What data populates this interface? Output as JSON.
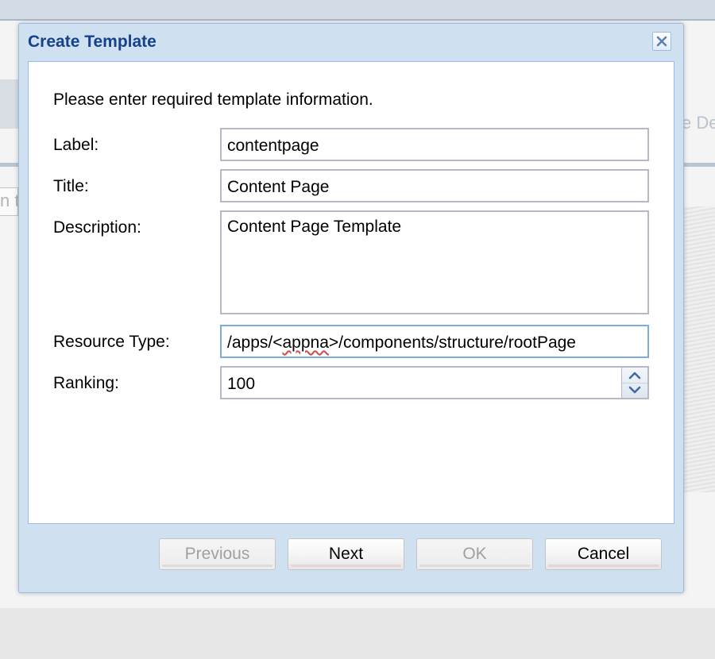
{
  "dialog": {
    "title": "Create Template",
    "intro": "Please enter required template information."
  },
  "fields": {
    "label": {
      "label": "Label:",
      "value": "contentpage"
    },
    "title": {
      "label": "Title:",
      "value": "Content Page"
    },
    "description": {
      "label": "Description:",
      "value": "Content Page Template"
    },
    "resource_type": {
      "label": "Resource Type:",
      "value_prefix": "/apps/<",
      "value_misspelled": "appna",
      "value_suffix": ">/components/structure/rootPage"
    },
    "ranking": {
      "label": "Ranking:",
      "value": "100"
    }
  },
  "buttons": {
    "previous": "Previous",
    "next": "Next",
    "ok": "OK",
    "cancel": "Cancel"
  },
  "background": {
    "text_right": "e De",
    "text_left": "n t"
  },
  "icons": {
    "close": "close-icon",
    "spin_up": "chevron-up-icon",
    "spin_down": "chevron-down-icon"
  },
  "colors": {
    "title": "#15428b",
    "dialog_frame": "#cfe0f1",
    "border": "#99bbe8"
  }
}
